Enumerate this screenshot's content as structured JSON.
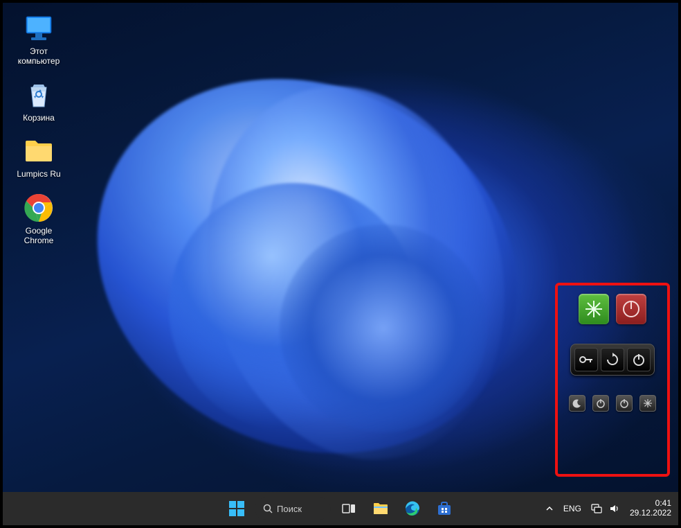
{
  "desktop": {
    "icons": [
      {
        "id": "this-pc",
        "label": "Этот\nкомпьютер"
      },
      {
        "id": "recycle",
        "label": "Корзина"
      },
      {
        "id": "folder",
        "label": "Lumpics Ru"
      },
      {
        "id": "chrome",
        "label": "Google\nChrome"
      }
    ]
  },
  "gadgets": {
    "row1": [
      {
        "id": "logoff-green",
        "icon": "burst"
      },
      {
        "id": "shutdown-red",
        "icon": "power-clock"
      }
    ],
    "row2": [
      {
        "id": "lock",
        "icon": "key"
      },
      {
        "id": "restart",
        "icon": "restart"
      },
      {
        "id": "power",
        "icon": "power"
      }
    ],
    "row3": [
      {
        "id": "mini-sleep",
        "icon": "moon"
      },
      {
        "id": "mini-power",
        "icon": "power"
      },
      {
        "id": "mini-standby",
        "icon": "power"
      },
      {
        "id": "mini-logoff",
        "icon": "burst"
      }
    ]
  },
  "taskbar": {
    "search_label": "Поиск",
    "pinned": [
      {
        "id": "start"
      },
      {
        "id": "search"
      },
      {
        "id": "task-view"
      },
      {
        "id": "explorer"
      },
      {
        "id": "edge"
      },
      {
        "id": "store"
      }
    ],
    "tray": {
      "chevron": "^",
      "language": "ENG",
      "time": "0:41",
      "date": "29.12.2022"
    }
  }
}
